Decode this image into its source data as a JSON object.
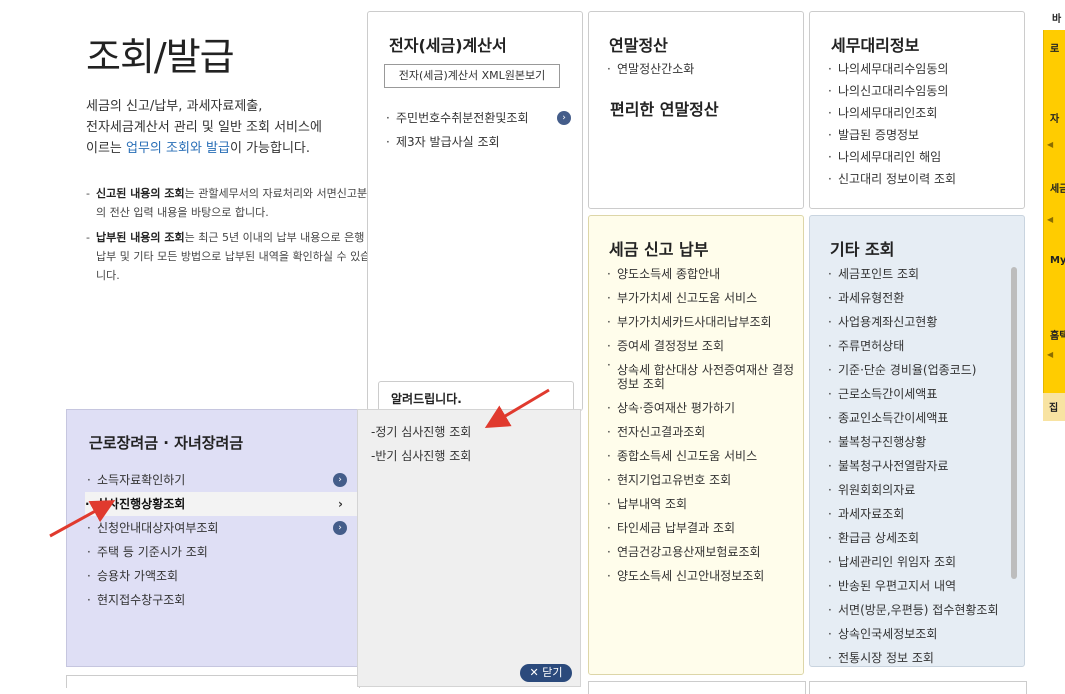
{
  "page": {
    "title": "조회/발급",
    "intro_line1": "세금의 신고/납부, 과세자료제출,",
    "intro_line2": "전자세금계산서 관리 및 일반 조회 서비스에",
    "intro_line3_pre": "이르는 ",
    "intro_line3_hl": "업무의 조회와 발급",
    "intro_line3_post": "이 가능합니다.",
    "note1_bold": "신고된 내용의 조회",
    "note1_text": "는 관할세무서의 자료처리와 서면신고분의 전산 입력 내용을 바탕으로 합니다.",
    "note2_bold": "납부된 내용의 조회",
    "note2_text": "는 최근 5년 이내의 납부 내용으로 은행 납부 및 기타 모든 방법으로 납부된 내역을 확인하실 수 있습니다."
  },
  "etax": {
    "title": "전자(세금)계산서",
    "button": "전자(세금)계산서 XML원본보기",
    "items": [
      "주민번호수취분전환및조회",
      "제3자 발급사실 조회"
    ]
  },
  "notice": {
    "title": "알려드립니다."
  },
  "year_end": {
    "title": "연말정산",
    "items": [
      "연말정산간소화"
    ],
    "sub_title": "편리한 연말정산"
  },
  "agent": {
    "title": "세무대리정보",
    "items": [
      "나의세무대리수임동의",
      "나의신고대리수임동의",
      "나의세무대리인조회",
      "발급된 증명정보",
      "나의세무대리인 해임",
      "신고대리 정보이력 조회"
    ]
  },
  "tax_report": {
    "title": "세금 신고 납부",
    "items": [
      "양도소득세 종합안내",
      "부가가치세 신고도움 서비스",
      "부가가치세카드사대리납부조회",
      "증여세 결정정보 조회",
      "상속세 합산대상 사전증여재산 결정정보 조회",
      "상속·증여재산 평가하기",
      "전자신고결과조회",
      "종합소득세 신고도움 서비스",
      "현지기업고유번호 조회",
      "납부내역 조회",
      "타인세금 납부결과 조회",
      "연금건강고용산재보험료조회",
      "양도소득세 신고안내정보조회"
    ]
  },
  "etc": {
    "title": "기타 조회",
    "items": [
      "세금포인트 조회",
      "과세유형전환",
      "사업용계좌신고현황",
      "주류면허상태",
      "기준·단순 경비율(업종코드)",
      "근로소득간이세액표",
      "종교인소득간이세액표",
      "불복청구진행상황",
      "불복청구사전열람자료",
      "위원회회의자료",
      "과세자료조회",
      "환급금 상세조회",
      "납세관리인 위임자 조회",
      "반송된 우편고지서 내역",
      "서면(방문,우편등) 접수현황조회",
      "상속인국세정보조회",
      "전통시장 정보 조회"
    ]
  },
  "flyout": {
    "title": "근로장려금 · 자녀장려금",
    "items": [
      "소득자료확인하기",
      "심사진행상황조회",
      "신청안내대상자여부조회",
      "주택 등 기준시가 조회",
      "승용차 가액조회",
      "현지접수창구조회"
    ],
    "sub_items": [
      "-정기 심사진행 조회",
      "-반기 심사진행 조회"
    ],
    "close_label": "✕ 닫기",
    "chevron": "›",
    "circle_arrow": "›"
  },
  "right_rail": {
    "top_label": "바",
    "labels": [
      "로",
      "자",
      "세금",
      "My",
      "홈택"
    ],
    "foot": "집"
  },
  "colors": {
    "arrow_red": "#e03a2e",
    "rail_yellow": "#ffcc00",
    "flyout_bg": "#dfdff5"
  }
}
